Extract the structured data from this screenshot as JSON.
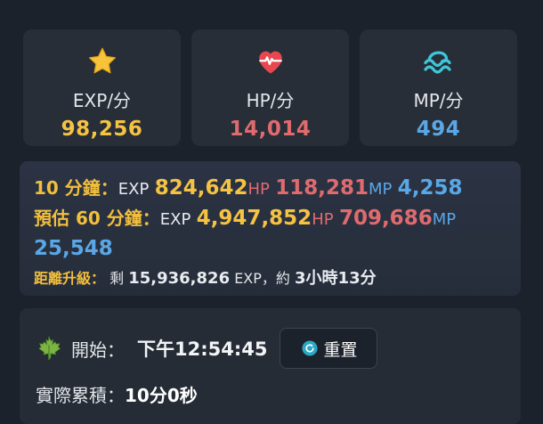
{
  "stats": [
    {
      "icon": "star-icon",
      "label": "EXP/分",
      "value": "98,256",
      "color": "#f5c242"
    },
    {
      "icon": "heart-pulse-icon",
      "label": "HP/分",
      "value": "14,014",
      "color": "#e06b6e"
    },
    {
      "icon": "water-wave-icon",
      "label": "MP/分",
      "value": "494",
      "color": "#5aa7e6"
    }
  ],
  "summary": {
    "ten_min": {
      "label": "10 分鐘：",
      "exp_tag": "EXP",
      "exp": "824,642",
      "hp_tag": "HP",
      "hp": "118,281",
      "mp_tag": "MP",
      "mp": "4,258"
    },
    "sixty_min": {
      "label": "預估 60 分鐘：",
      "exp_tag": "EXP",
      "exp": "4,947,852",
      "hp_tag": "HP",
      "hp": "709,686",
      "mp_tag": "MP",
      "mp": "25,548"
    },
    "level_up": {
      "label": "距離升級：",
      "remain_prefix": "剩",
      "remain_exp": "15,936,826",
      "exp_suffix": "EXP，約",
      "eta": "3小時13分"
    }
  },
  "timer": {
    "start_label": "開始：",
    "start_time": "下午12:54:45",
    "reset_label": "重置",
    "elapsed_label": "實際累積：",
    "elapsed_value": "10分0秒"
  }
}
